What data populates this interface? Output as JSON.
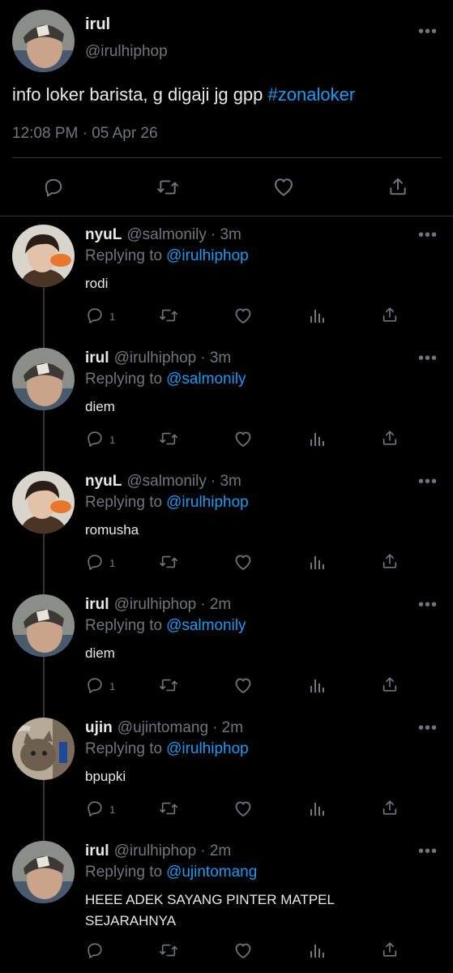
{
  "main_tweet": {
    "name": "irul",
    "handle": "@irulhiphop",
    "text_plain": "info loker barista, g digaji jg gpp ",
    "hashtag": "#zonaloker",
    "timestamp": "12:08 PM · 05 Apr 26",
    "more": "•••"
  },
  "replies": [
    {
      "name": "nyuL",
      "handle": "@salmonily",
      "time": "· 3m",
      "replying_label": "Replying to",
      "replying_to": "@irulhiphop",
      "text": "rodi",
      "reply_count": "1",
      "avatar": "orange-shirt"
    },
    {
      "name": "irul",
      "handle": "@irulhiphop",
      "time": "· 3m",
      "replying_label": "Replying to",
      "replying_to": "@salmonily",
      "text": "diem",
      "reply_count": "1",
      "avatar": "cap"
    },
    {
      "name": "nyuL",
      "handle": "@salmonily",
      "time": "· 3m",
      "replying_label": "Replying to",
      "replying_to": "@irulhiphop",
      "text": "romusha",
      "reply_count": "1",
      "avatar": "orange-shirt"
    },
    {
      "name": "irul",
      "handle": "@irulhiphop",
      "time": "· 2m",
      "replying_label": "Replying to",
      "replying_to": "@salmonily",
      "text": "diem",
      "reply_count": "1",
      "avatar": "cap"
    },
    {
      "name": "ujin",
      "handle": "@ujintomang",
      "time": "· 2m",
      "replying_label": "Replying to",
      "replying_to": "@irulhiphop",
      "text": "bpupki",
      "reply_count": "1",
      "avatar": "cat"
    },
    {
      "name": "irul",
      "handle": "@irulhiphop",
      "time": "· 2m",
      "replying_label": "Replying to",
      "replying_to": "@ujintomang",
      "text": "HEEE ADEK SAYANG PINTER MATPEL SEJARAHNYA",
      "reply_count": "",
      "avatar": "cap"
    }
  ],
  "colors": {
    "background": "#000000",
    "text": "#e7e9ea",
    "muted": "#71767b",
    "link": "#1d9bf0"
  }
}
